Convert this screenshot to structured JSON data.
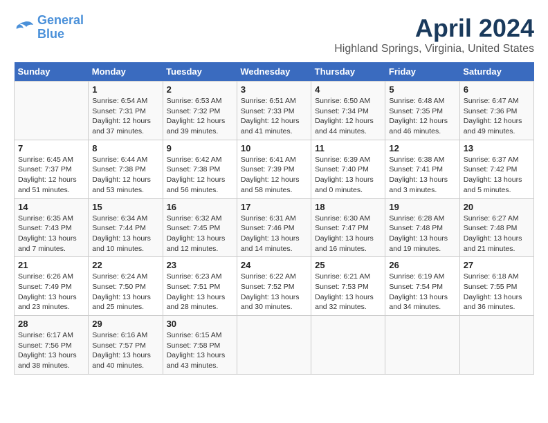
{
  "header": {
    "logo_line1": "General",
    "logo_line2": "Blue",
    "title": "April 2024",
    "subtitle": "Highland Springs, Virginia, United States"
  },
  "days_of_week": [
    "Sunday",
    "Monday",
    "Tuesday",
    "Wednesday",
    "Thursday",
    "Friday",
    "Saturday"
  ],
  "weeks": [
    [
      {
        "day": "",
        "info": ""
      },
      {
        "day": "1",
        "info": "Sunrise: 6:54 AM\nSunset: 7:31 PM\nDaylight: 12 hours\nand 37 minutes."
      },
      {
        "day": "2",
        "info": "Sunrise: 6:53 AM\nSunset: 7:32 PM\nDaylight: 12 hours\nand 39 minutes."
      },
      {
        "day": "3",
        "info": "Sunrise: 6:51 AM\nSunset: 7:33 PM\nDaylight: 12 hours\nand 41 minutes."
      },
      {
        "day": "4",
        "info": "Sunrise: 6:50 AM\nSunset: 7:34 PM\nDaylight: 12 hours\nand 44 minutes."
      },
      {
        "day": "5",
        "info": "Sunrise: 6:48 AM\nSunset: 7:35 PM\nDaylight: 12 hours\nand 46 minutes."
      },
      {
        "day": "6",
        "info": "Sunrise: 6:47 AM\nSunset: 7:36 PM\nDaylight: 12 hours\nand 49 minutes."
      }
    ],
    [
      {
        "day": "7",
        "info": "Sunrise: 6:45 AM\nSunset: 7:37 PM\nDaylight: 12 hours\nand 51 minutes."
      },
      {
        "day": "8",
        "info": "Sunrise: 6:44 AM\nSunset: 7:38 PM\nDaylight: 12 hours\nand 53 minutes."
      },
      {
        "day": "9",
        "info": "Sunrise: 6:42 AM\nSunset: 7:38 PM\nDaylight: 12 hours\nand 56 minutes."
      },
      {
        "day": "10",
        "info": "Sunrise: 6:41 AM\nSunset: 7:39 PM\nDaylight: 12 hours\nand 58 minutes."
      },
      {
        "day": "11",
        "info": "Sunrise: 6:39 AM\nSunset: 7:40 PM\nDaylight: 13 hours\nand 0 minutes."
      },
      {
        "day": "12",
        "info": "Sunrise: 6:38 AM\nSunset: 7:41 PM\nDaylight: 13 hours\nand 3 minutes."
      },
      {
        "day": "13",
        "info": "Sunrise: 6:37 AM\nSunset: 7:42 PM\nDaylight: 13 hours\nand 5 minutes."
      }
    ],
    [
      {
        "day": "14",
        "info": "Sunrise: 6:35 AM\nSunset: 7:43 PM\nDaylight: 13 hours\nand 7 minutes."
      },
      {
        "day": "15",
        "info": "Sunrise: 6:34 AM\nSunset: 7:44 PM\nDaylight: 13 hours\nand 10 minutes."
      },
      {
        "day": "16",
        "info": "Sunrise: 6:32 AM\nSunset: 7:45 PM\nDaylight: 13 hours\nand 12 minutes."
      },
      {
        "day": "17",
        "info": "Sunrise: 6:31 AM\nSunset: 7:46 PM\nDaylight: 13 hours\nand 14 minutes."
      },
      {
        "day": "18",
        "info": "Sunrise: 6:30 AM\nSunset: 7:47 PM\nDaylight: 13 hours\nand 16 minutes."
      },
      {
        "day": "19",
        "info": "Sunrise: 6:28 AM\nSunset: 7:48 PM\nDaylight: 13 hours\nand 19 minutes."
      },
      {
        "day": "20",
        "info": "Sunrise: 6:27 AM\nSunset: 7:48 PM\nDaylight: 13 hours\nand 21 minutes."
      }
    ],
    [
      {
        "day": "21",
        "info": "Sunrise: 6:26 AM\nSunset: 7:49 PM\nDaylight: 13 hours\nand 23 minutes."
      },
      {
        "day": "22",
        "info": "Sunrise: 6:24 AM\nSunset: 7:50 PM\nDaylight: 13 hours\nand 25 minutes."
      },
      {
        "day": "23",
        "info": "Sunrise: 6:23 AM\nSunset: 7:51 PM\nDaylight: 13 hours\nand 28 minutes."
      },
      {
        "day": "24",
        "info": "Sunrise: 6:22 AM\nSunset: 7:52 PM\nDaylight: 13 hours\nand 30 minutes."
      },
      {
        "day": "25",
        "info": "Sunrise: 6:21 AM\nSunset: 7:53 PM\nDaylight: 13 hours\nand 32 minutes."
      },
      {
        "day": "26",
        "info": "Sunrise: 6:19 AM\nSunset: 7:54 PM\nDaylight: 13 hours\nand 34 minutes."
      },
      {
        "day": "27",
        "info": "Sunrise: 6:18 AM\nSunset: 7:55 PM\nDaylight: 13 hours\nand 36 minutes."
      }
    ],
    [
      {
        "day": "28",
        "info": "Sunrise: 6:17 AM\nSunset: 7:56 PM\nDaylight: 13 hours\nand 38 minutes."
      },
      {
        "day": "29",
        "info": "Sunrise: 6:16 AM\nSunset: 7:57 PM\nDaylight: 13 hours\nand 40 minutes."
      },
      {
        "day": "30",
        "info": "Sunrise: 6:15 AM\nSunset: 7:58 PM\nDaylight: 13 hours\nand 43 minutes."
      },
      {
        "day": "",
        "info": ""
      },
      {
        "day": "",
        "info": ""
      },
      {
        "day": "",
        "info": ""
      },
      {
        "day": "",
        "info": ""
      }
    ]
  ]
}
